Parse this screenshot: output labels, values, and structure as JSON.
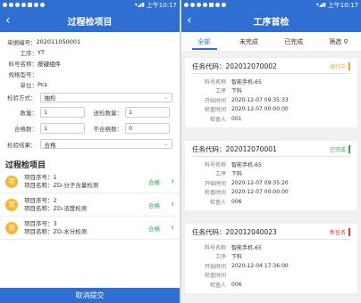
{
  "status": {
    "time": "上午10:17"
  },
  "left": {
    "title": "过程检项目",
    "fields": {
      "order_label": "单据编号：",
      "order_value": "202011050001",
      "step_label": "工序：",
      "step_value": "YT",
      "material_label": "料号名称：",
      "material_value": "按键组件",
      "spec_label": "规格型号：",
      "spec_value": "",
      "unit_label": "单位：",
      "unit_value": "Pcs",
      "method_label": "检验方式：",
      "method_value": "抽检",
      "qty_label": "数量：",
      "qty_value": "1",
      "send_label": "送检数量：",
      "send_value": "1",
      "pass_label": "合格数：",
      "pass_value": "1",
      "fail_label": "不合格数：",
      "fail_value": "0",
      "result_label": "检验结果：",
      "result_value": "合格"
    },
    "section_title": "过程检项目",
    "items": [
      {
        "icon": "项",
        "seq": "项目序号：1",
        "name": "项目名称：ZD-分子含量检测",
        "status": "合格"
      },
      {
        "icon": "项",
        "seq": "项目序号：2",
        "name": "项目名称：ZD-浓度检测",
        "status": "合格"
      },
      {
        "icon": "项",
        "seq": "项目序号：3",
        "name": "项目名称：ZD-水分检测",
        "status": "合格"
      }
    ],
    "submit": "取消提交"
  },
  "right": {
    "title": "工序首检",
    "tabs": [
      "全部",
      "未完成",
      "已完成",
      "筛选"
    ],
    "cards": [
      {
        "code_label": "任务代码：",
        "code": "202012070002",
        "badge": "进行中",
        "badge_color": "#f5a623",
        "rows": [
          [
            "料号名称",
            "智能手机-65"
          ],
          [
            "工序",
            "下料"
          ],
          [
            "开始时间",
            "2020-12-07 09:35:33"
          ],
          [
            "检查时间",
            "2020-12-07 00:00:00"
          ],
          [
            "检查人",
            "001"
          ]
        ]
      },
      {
        "code_label": "任务代码：",
        "code": "202012070001",
        "badge": "已完成",
        "badge_color": "#2fa84f",
        "rows": [
          [
            "料号名称",
            "智能手机-65"
          ],
          [
            "工序",
            "下料"
          ],
          [
            "开始时间",
            "2020-12-07 09:35:20"
          ],
          [
            "检查时间",
            "2020-12-07 00:00:00"
          ],
          [
            "检查人",
            "006"
          ]
        ]
      },
      {
        "code_label": "任务代码：",
        "code": "202012040023",
        "badge": "新任务",
        "badge_color": "#e03b3b",
        "rows": [
          [
            "料号名称",
            "智能手机-65"
          ],
          [
            "工序",
            "下料"
          ],
          [
            "开始时间",
            "2020-12-04 17:36:00"
          ],
          [
            "检查时间",
            ""
          ],
          [
            "检查人",
            "006"
          ]
        ]
      }
    ]
  }
}
